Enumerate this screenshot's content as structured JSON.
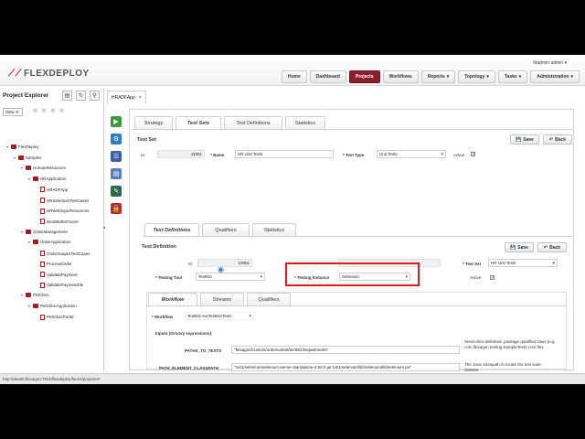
{
  "app": {
    "logo_text": "FLEXDEPLOY",
    "user": "fdadmin",
    "user_suffix": "admin ▾"
  },
  "nav": [
    {
      "label": "Home",
      "active": false,
      "dropdown": false
    },
    {
      "label": "Dashboard",
      "active": false,
      "dropdown": false
    },
    {
      "label": "Projects",
      "active": true,
      "dropdown": false
    },
    {
      "label": "Workflows",
      "active": false,
      "dropdown": false
    },
    {
      "label": "Reports",
      "active": false,
      "dropdown": true
    },
    {
      "label": "Topology",
      "active": false,
      "dropdown": true
    },
    {
      "label": "Tasks",
      "active": false,
      "dropdown": true
    },
    {
      "label": "Administration",
      "active": false,
      "dropdown": true
    }
  ],
  "explorer": {
    "title": "Project Explorer",
    "view_label": "View",
    "tree": [
      {
        "label": "FlexDeploy",
        "level": 0,
        "type": "folder"
      },
      {
        "label": "Samples",
        "level": 1,
        "type": "folder"
      },
      {
        "label": "HumanResources",
        "level": 2,
        "type": "folder"
      },
      {
        "label": "HRApplication",
        "level": 3,
        "type": "folder"
      },
      {
        "label": "HRADFApp",
        "level": 4,
        "type": "doc"
      },
      {
        "label": "HRSeleniumTestCases",
        "level": 4,
        "type": "doc"
      },
      {
        "label": "HRWeblogicResources",
        "level": 4,
        "type": "doc"
      },
      {
        "label": "WorkBetterFaces",
        "level": 4,
        "type": "doc"
      },
      {
        "label": "OrderManagement",
        "level": 2,
        "type": "folder"
      },
      {
        "label": "OrderApplication",
        "level": 3,
        "type": "folder"
      },
      {
        "label": "OrderSoapUITestCases",
        "level": 4,
        "type": "doc"
      },
      {
        "label": "ProcessOrder",
        "level": 4,
        "type": "doc"
      },
      {
        "label": "ValidatePayment",
        "level": 4,
        "type": "doc"
      },
      {
        "label": "ValidatePaymentSB",
        "level": 4,
        "type": "doc"
      },
      {
        "label": "PetClinic",
        "level": 2,
        "type": "folder"
      },
      {
        "label": "PetClinicApplication",
        "level": 3,
        "type": "folder"
      },
      {
        "label": "PetClinicPortal",
        "level": 4,
        "type": "doc"
      }
    ]
  },
  "main_tab": {
    "label": "HRADFApp",
    "close": "×"
  },
  "tabs_top": [
    "Strategy",
    "Test Sets",
    "Test Definitions",
    "Statistics"
  ],
  "test_set": {
    "section_title": "Test Set",
    "id_label": "Id",
    "id_value": "11001",
    "name_label": "Name",
    "name_value": "HR Unit Tests",
    "type_label": "Test Type",
    "type_value": "Unit Tests",
    "active_label": "Active",
    "save_label": "Save",
    "back_label": "Back"
  },
  "tabs_mid": [
    "Test Definitions",
    "Qualifiers",
    "Statistics"
  ],
  "test_def": {
    "section_title": "Test Definition",
    "id_label": "Id",
    "id_value": "10001",
    "testing_tool_label": "Testing Tool",
    "testing_tool_value": "TestNG",
    "testing_instance_label": "Testing Instance",
    "testing_instance_value": "Selenium",
    "test_set_label": "Test Set",
    "test_set_value": "HR Unit Tests",
    "active_label": "Active",
    "save_label": "Save",
    "back_label": "Back"
  },
  "tabs_inner": [
    "Workflow",
    "Streams",
    "Qualifiers"
  ],
  "workflow": {
    "label": "Workflow",
    "value": "TestNG-runTestNGTests",
    "inputs_title": "Inputs (Groovy expressions):",
    "inputs": [
      {
        "label": "PATHS_TO_TESTS",
        "value": "\"flexagon/custom/ordemo/test/testNG/Departments\"",
        "help": "Semicolon-delimited, package qualified class (e.g. com.flexagon.testing.SampleTest1;com.flex"
      },
      {
        "label": "PATH_ELEMENT_CLASSPATH",
        "value": "\"/u01/selenium/selenium-server-standalone-2.50.0.jar:/u01/selenium/lib/selenium/lib/selenium.jar\"",
        "help": "The Java classpath to locate the test suite, classes."
      }
    ]
  },
  "statusbar": {
    "url": "http://dev80.flexagon:7001/flexdeploy/faces/projects#"
  },
  "colors": {
    "accent": "#8b1d2c",
    "highlight": "#d81e1e",
    "tree_folder": "#a01e1e"
  }
}
